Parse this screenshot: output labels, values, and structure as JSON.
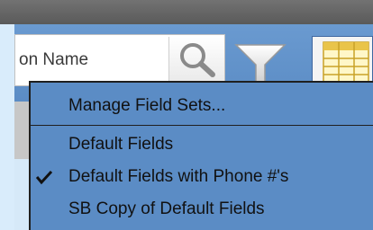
{
  "search": {
    "value": "on Name"
  },
  "menu": {
    "items": [
      {
        "label": "Manage Field Sets...",
        "checked": false
      },
      {
        "label": "Default Fields",
        "checked": false
      },
      {
        "label": "Default Fields with Phone #'s",
        "checked": true
      },
      {
        "label": "SB Copy of Default Fields",
        "checked": false
      }
    ]
  },
  "icons": {
    "search_button": "magnifier-icon",
    "filter_button": "funnel-icon",
    "grid_button": "grid-icon",
    "checkmark": "checkmark-icon"
  },
  "colors": {
    "toolbar": "#5b8cc5",
    "topbar": "#676767",
    "menu_background": "#5b8cc5",
    "text": "#111111"
  }
}
